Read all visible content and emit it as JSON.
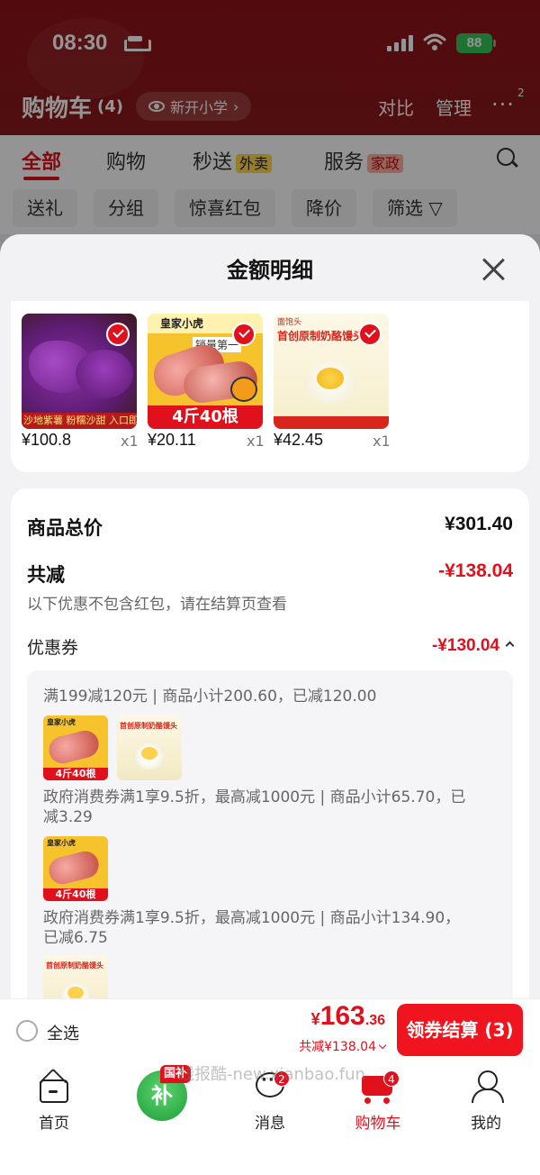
{
  "status_bar": {
    "time": "08:30",
    "battery": "88"
  },
  "cart_header": {
    "title": "购物车",
    "count": "(4)",
    "address": "新开小学",
    "compare": "对比",
    "manage": "管理",
    "more_badge": "2"
  },
  "tabs": [
    {
      "label": "全部"
    },
    {
      "label": "购物"
    },
    {
      "label": "秒送",
      "tag": "外卖"
    },
    {
      "label": "服务",
      "tag": "家政"
    }
  ],
  "filters": [
    "送礼",
    "分组",
    "惊喜红包",
    "降价",
    "筛选"
  ],
  "sheet": {
    "title": "金额明细"
  },
  "products": [
    {
      "price": "¥100.8",
      "qty": "x1",
      "caption": "沙地紫薯 粉糯沙甜 入口即化",
      "icon": "sweet-potato"
    },
    {
      "price": "¥20.11",
      "qty": "x1",
      "brand": "皇家小虎",
      "banner": "4斤40根",
      "sold": "销量第一",
      "icon": "sausage"
    },
    {
      "price": "¥42.45",
      "qty": "x1",
      "title": "首创原制奶酪馒头",
      "brand_small": "面饱头",
      "icon": "cheese-bun"
    }
  ],
  "breakdown": {
    "total_label": "商品总价",
    "total_value": "¥301.40",
    "discount_label": "共减",
    "discount_value": "-¥138.04",
    "note": "以下优惠不包含红包，请在结算页查看",
    "coupon_label": "优惠券",
    "coupon_value": "-¥130.04"
  },
  "coupon_lines": [
    "满199减120元 | 商品小计200.60，已减120.00",
    "政府消费券满1享9.5折，最高减1000元 | 商品小计65.70，已减3.29",
    "政府消费券满1享9.5折，最高减1000元 | 商品小计134.90，已减6.75"
  ],
  "checkout": {
    "select_all": "全选",
    "currency": "¥",
    "amount_int": "163",
    "amount_dec": ".36",
    "saved": "共减¥138.04",
    "button": "领券结算 (3)"
  },
  "tabbar": {
    "home": "首页",
    "subsidy_tag": "国补",
    "subsidy_char": "补",
    "messages": "消息",
    "messages_badge": "2",
    "cart": "购物车",
    "cart_badge": "4",
    "me": "我的"
  },
  "watermark": "线报酷-new.xianbao.fun",
  "colors": {
    "accent": "#e0111d",
    "dim_bg": "#8f1218",
    "subsidy_green": "#1f9e3a"
  }
}
